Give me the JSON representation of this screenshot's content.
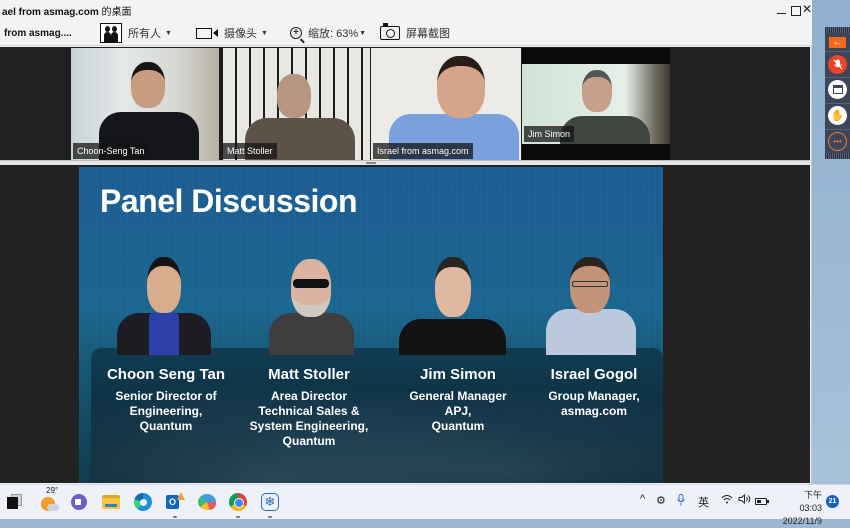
{
  "window": {
    "title_prefix": "ael from asmag.com",
    "title_suffix": " 的桌面",
    "buttons": {
      "minimize": "minimize",
      "maximize": "maximize",
      "close": "✕"
    }
  },
  "toolbar": {
    "host_label": "from asmag....",
    "people_label": "所有人",
    "camera_label": "摄像头",
    "zoom_label": "缩放: 63%",
    "screenshot_label": "屏幕截图",
    "caret": "▼"
  },
  "participants": [
    {
      "name": "Choon-Seng Tan"
    },
    {
      "name": "Matt Stoller"
    },
    {
      "name": "Israel from asmag.com"
    },
    {
      "name": "Jim Simon"
    }
  ],
  "slide": {
    "title": "Panel Discussion",
    "speakers": [
      {
        "name": "Choon Seng Tan",
        "role_lines": [
          "Senior Director of",
          "Engineering,",
          "Quantum"
        ]
      },
      {
        "name": "Matt Stoller",
        "role_lines": [
          "Area Director",
          "Technical Sales &",
          "System Engineering,",
          "Quantum"
        ]
      },
      {
        "name": "Jim Simon",
        "role_lines": [
          "General Manager",
          "APJ,",
          "Quantum"
        ]
      },
      {
        "name": "Israel Gogol",
        "role_lines": [
          "Group Manager,",
          "asmag.com"
        ]
      }
    ]
  },
  "side_controls": {
    "back": "←",
    "mic": "mic-muted",
    "hand": "✋",
    "chat": "•••"
  },
  "taskbar": {
    "weather_temp": "29°",
    "tray": {
      "chevron": "^",
      "ime": "英",
      "wifi": "wifi",
      "volume": "volume"
    },
    "clock_time": "下午 03:03",
    "clock_date": "2022/11/9",
    "notification_count": "21"
  },
  "colors": {
    "slide_blue": "#1d5d92",
    "accent_orange": "#f26a21",
    "mic_red": "#e8452a"
  }
}
